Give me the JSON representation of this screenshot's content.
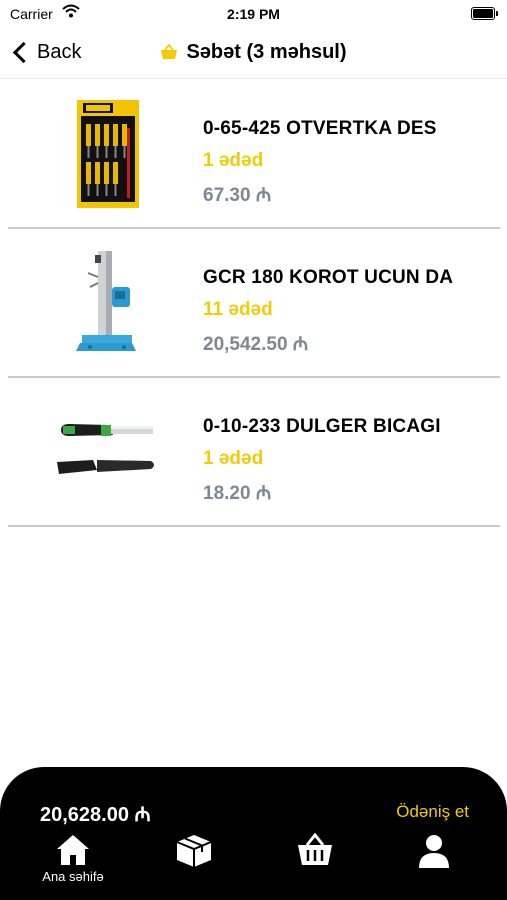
{
  "status_bar": {
    "carrier": "Carrier",
    "time": "2:19 PM"
  },
  "nav": {
    "back_label": "Back",
    "title": "Səbət (3 məhsul)"
  },
  "cart_items": [
    {
      "name": "0-65-425 OTVERTKA DES",
      "quantity": "1 ədəd",
      "price": "67.30 ₼"
    },
    {
      "name": "GCR 180 KOROT UCUN DA",
      "quantity": "11 ədəd",
      "price": "20,542.50 ₼"
    },
    {
      "name": "0-10-233 DULGER BICAGI",
      "quantity": "1 ədəd",
      "price": "18.20 ₼"
    }
  ],
  "footer": {
    "total": "20,628.00 ₼",
    "checkout_label": "Ödəniş et",
    "tabs": [
      {
        "label": "Ana səhifə",
        "icon": "home-icon"
      },
      {
        "label": "",
        "icon": "box-icon"
      },
      {
        "label": "",
        "icon": "basket-icon"
      },
      {
        "label": "",
        "icon": "user-icon"
      }
    ]
  },
  "colors": {
    "accent": "#F2CB05",
    "price": "#7C8894",
    "divider": "#C8C8C8",
    "footer_bg": "#000000"
  }
}
